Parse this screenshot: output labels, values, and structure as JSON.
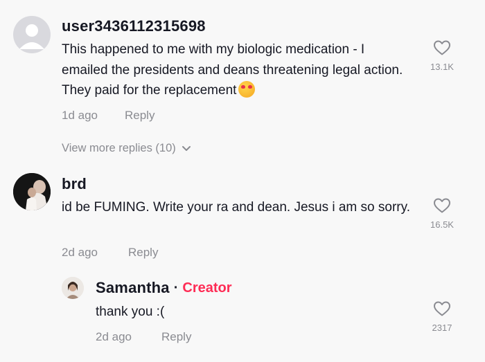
{
  "comments": [
    {
      "username": "user3436112315698",
      "text": "This happened to me with my biologic medication - I emailed the presidents and deans threatening legal action. They paid for the replacement",
      "emoji": "smiling-face-with-hearts",
      "time": "1d ago",
      "reply_label": "Reply",
      "like_count": "13.1K",
      "view_more": "View more replies (10)"
    },
    {
      "username": "brd",
      "text": "id be FUMING. Write your ra and dean. Jesus i am so sorry.",
      "time": "2d ago",
      "reply_label": "Reply",
      "like_count": "16.5K"
    }
  ],
  "reply": {
    "username": "Samantha",
    "separator": "·",
    "badge": "Creator",
    "text": "thank you :(",
    "time": "2d ago",
    "reply_label": "Reply",
    "like_count": "2317"
  },
  "colors": {
    "background": "#f8f8f8",
    "text": "#161823",
    "muted": "#8a8b91",
    "creator_accent": "#fe2c55"
  }
}
